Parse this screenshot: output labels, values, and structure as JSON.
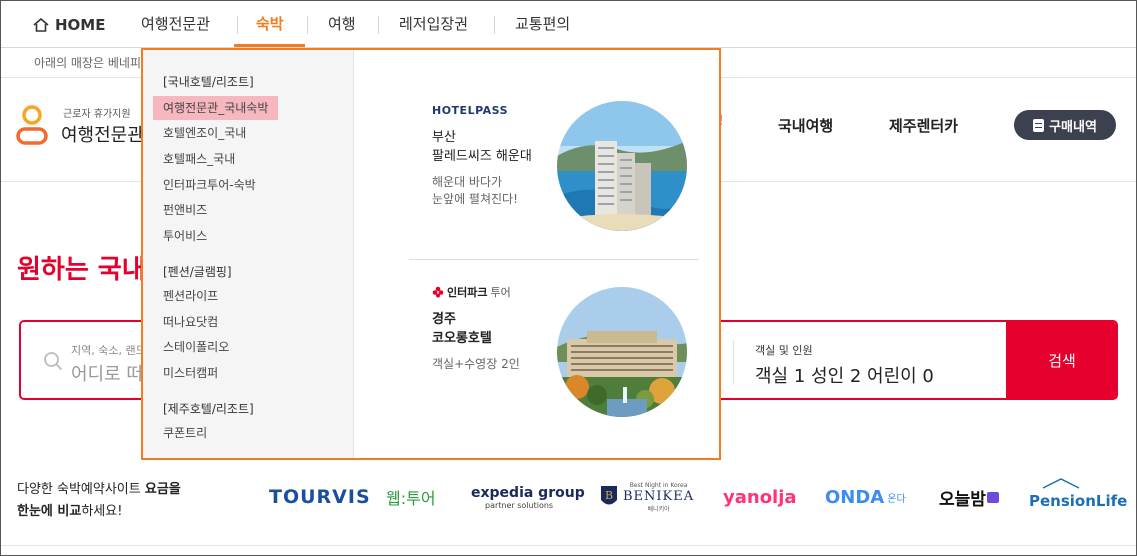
{
  "topnav": {
    "home": "HOME",
    "items": [
      "여행전문관",
      "숙박",
      "여행",
      "레저입장권",
      "교통편의"
    ],
    "active_index": 1
  },
  "notice": "아래의 매장은 베네피",
  "header": {
    "logo_sub": "근로자 휴가지원",
    "logo_title": "여행전문관",
    "gnb": [
      "국내여행",
      "제주렌터카"
    ],
    "purchase_button": "구매내역"
  },
  "hero": {
    "title": "원하는 국내"
  },
  "search": {
    "hint": "지역, 숙소, 랜드",
    "placeholder": "어디로 떠",
    "guest_label": "객실 및 인원",
    "guest_value": "객실 1  성인 2  어린이 0",
    "button": "검색"
  },
  "compare": {
    "line1_plain": "다양한 숙박예약사이트 ",
    "line1_bold": "요금을",
    "line2_bold": "한눈에 비교",
    "line2_plain": "하세요!"
  },
  "partner_logos": [
    "TOURVIS",
    "웹:투어",
    "expedia group",
    "partner solutions",
    "Best Night in Korea",
    "BENIKEA",
    "베니키아",
    "yanolja",
    "ONDA",
    "온다",
    "오늘밤",
    "PensionLife"
  ],
  "dropdown": {
    "sections": [
      {
        "category": "[국내호텔/리조트]",
        "items": [
          "여행전문관_국내숙박",
          "호텔엔조이_국내",
          "호텔패스_국내",
          "인터파크투어-숙박",
          "펀앤비즈",
          "투어비스"
        ]
      },
      {
        "category": "[펜션/글램핑]",
        "items": [
          "펜션라이프",
          "떠나요닷컴",
          "스테이폴리오",
          "미스터캠퍼"
        ]
      },
      {
        "category": "[제주호텔/리조트]",
        "items": [
          "쿠폰트리"
        ]
      }
    ],
    "highlighted_item": "여행전문관_국내숙박",
    "cards": [
      {
        "brand": "HOTELPASS",
        "title_line1": "부산",
        "title_line2": "팔레드씨즈 해운대",
        "desc_line1": "해운대 바다가",
        "desc_line2": "눈앞에 펼쳐진다!"
      },
      {
        "brand": "인터파크",
        "brand_suffix": "투어",
        "title_line1": "경주",
        "title_line2": "코오롱호텔",
        "desc_line1": "객실+수영장 2인"
      }
    ]
  },
  "colors": {
    "accent_orange": "#f47b20",
    "brand_red": "#e6002d",
    "dark_button": "#3c4150"
  }
}
